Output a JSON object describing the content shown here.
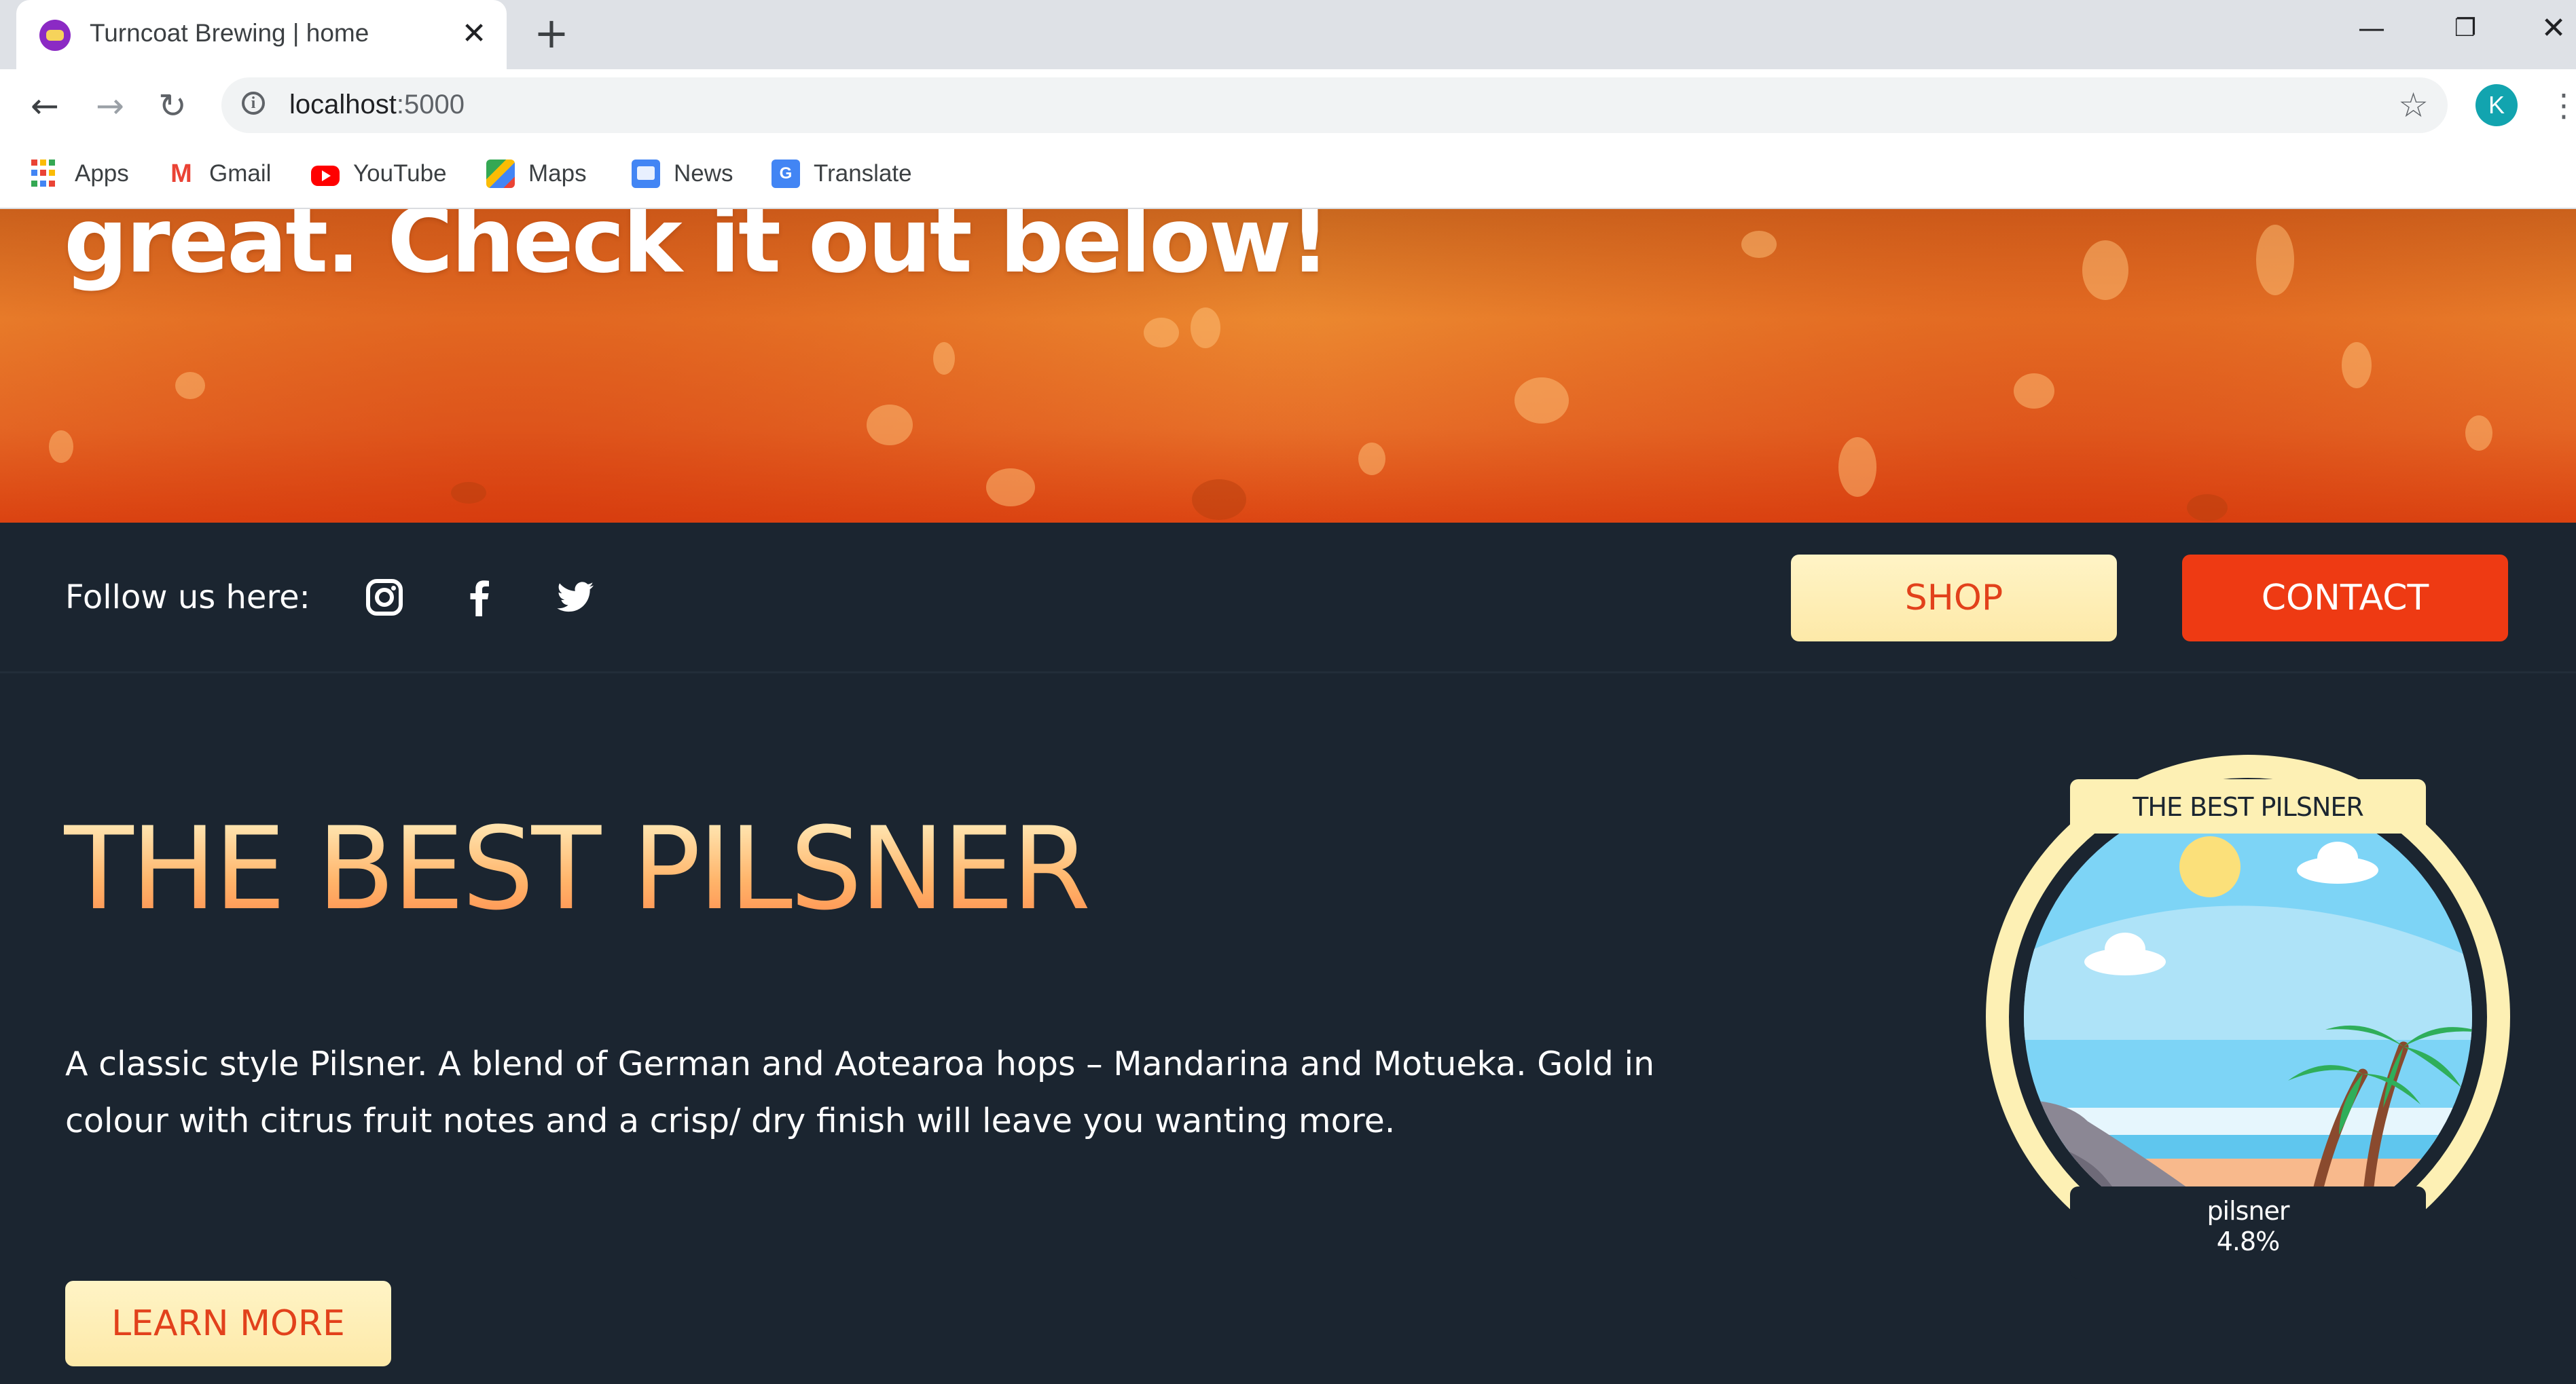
{
  "browser": {
    "tab_title": "Turncoat Brewing | home",
    "url_host": "localhost",
    "url_port": ":5000",
    "profile_initial": "K",
    "bookmarks": [
      {
        "label": "Apps",
        "icon": "apps-grid-icon"
      },
      {
        "label": "Gmail",
        "icon": "gmail-icon"
      },
      {
        "label": "YouTube",
        "icon": "youtube-icon"
      },
      {
        "label": "Maps",
        "icon": "maps-icon"
      },
      {
        "label": "News",
        "icon": "news-icon"
      },
      {
        "label": "Translate",
        "icon": "translate-icon"
      }
    ]
  },
  "hero": {
    "text": "great. Check it out below!"
  },
  "follow": {
    "label": "Follow us here:",
    "socials": [
      "instagram-icon",
      "facebook-icon",
      "twitter-icon"
    ],
    "shop_label": "SHOP",
    "contact_label": "CONTACT"
  },
  "product": {
    "title": "THE BEST PILSNER",
    "description": "A classic style Pilsner. A blend of German and Aotearoa hops – Mandarina and Motueka. Gold in colour with citrus fruit notes and a crisp/ dry finish will leave you wanting more.",
    "learn_more_label": "LEARN MORE",
    "badge": {
      "top_label": "THE BEST PILSNER",
      "style": "pilsner",
      "abv": "4.8%"
    }
  },
  "colors": {
    "page_background": "#1b2530",
    "accent_red": "#ee3a13",
    "cream": "#fdedb3",
    "hero_orange": "#ec8a30"
  }
}
